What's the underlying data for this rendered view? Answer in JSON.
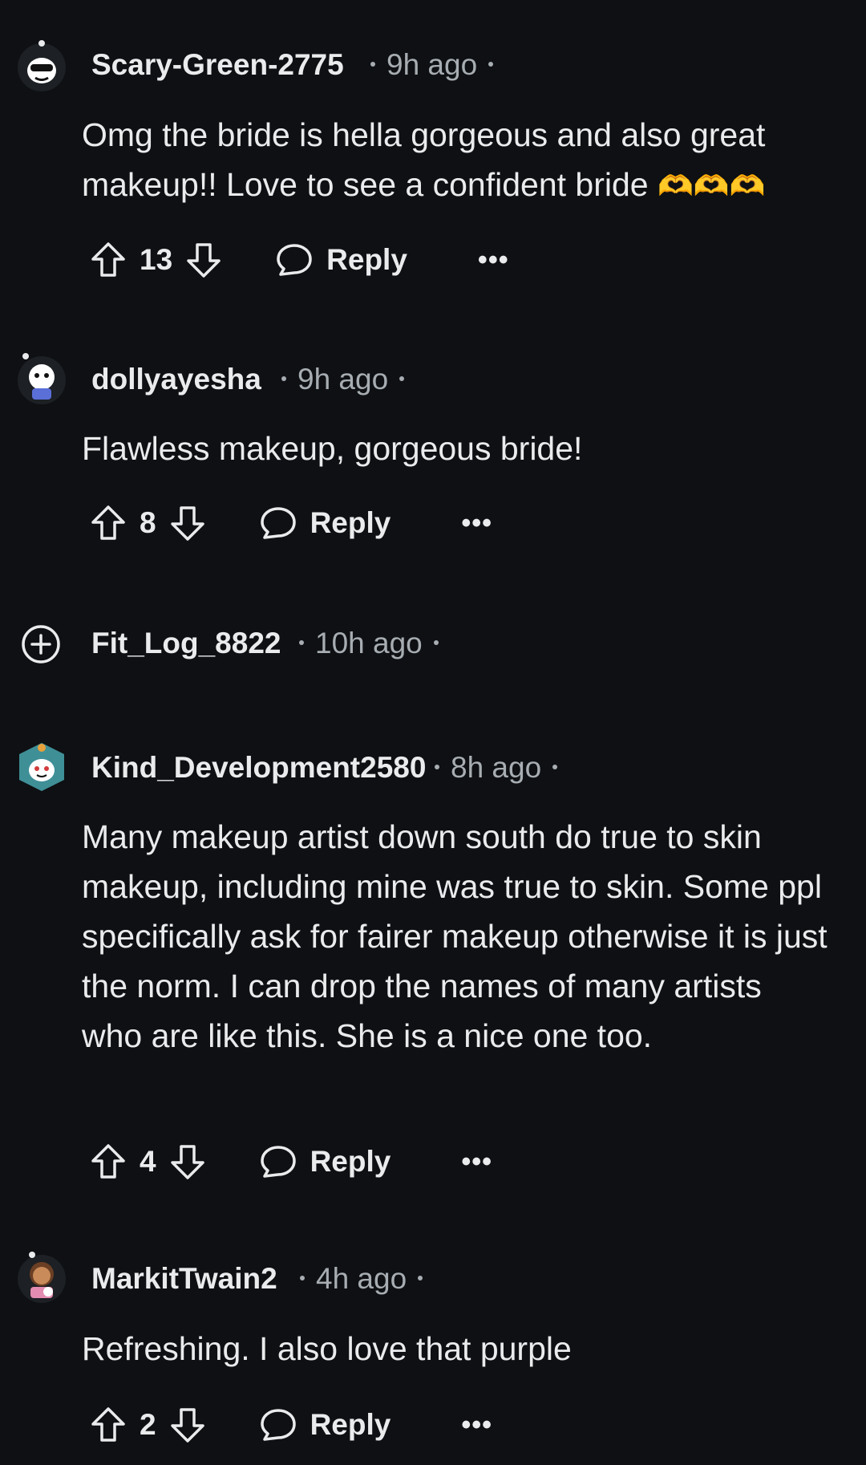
{
  "comments": [
    {
      "username": "Scary-Green-2775",
      "time": "9h ago",
      "body": "Omg the bride is hella gorgeous and also great makeup!! Love to see a confident bride",
      "emoji": "🫶🫶🫶",
      "score": "13",
      "reply_label": "Reply",
      "more_label": "•••"
    },
    {
      "username": "dollyayesha",
      "time": "9h ago",
      "body": "Flawless makeup, gorgeous bride!",
      "score": "8",
      "reply_label": "Reply",
      "more_label": "•••"
    },
    {
      "username": "Fit_Log_8822",
      "time": "10h ago",
      "collapsed": true
    },
    {
      "username": "Kind_Development2580",
      "time": "8h ago",
      "body": "Many makeup artist down south do true to skin makeup, including mine was true to skin. Some ppl specifically ask for fairer makeup otherwise it is just the norm. I can drop the names of many artists who are like this. She is a nice one too.",
      "score": "4",
      "reply_label": "Reply",
      "more_label": "•••"
    },
    {
      "username": "MarkitTwain2",
      "time": "4h ago",
      "body": "Refreshing. I also love that purple",
      "score": "2",
      "reply_label": "Reply",
      "more_label": "•••"
    }
  ],
  "colors": {
    "background": "#0e1013",
    "text": "#e9ebec",
    "meta": "#a7adb2"
  }
}
